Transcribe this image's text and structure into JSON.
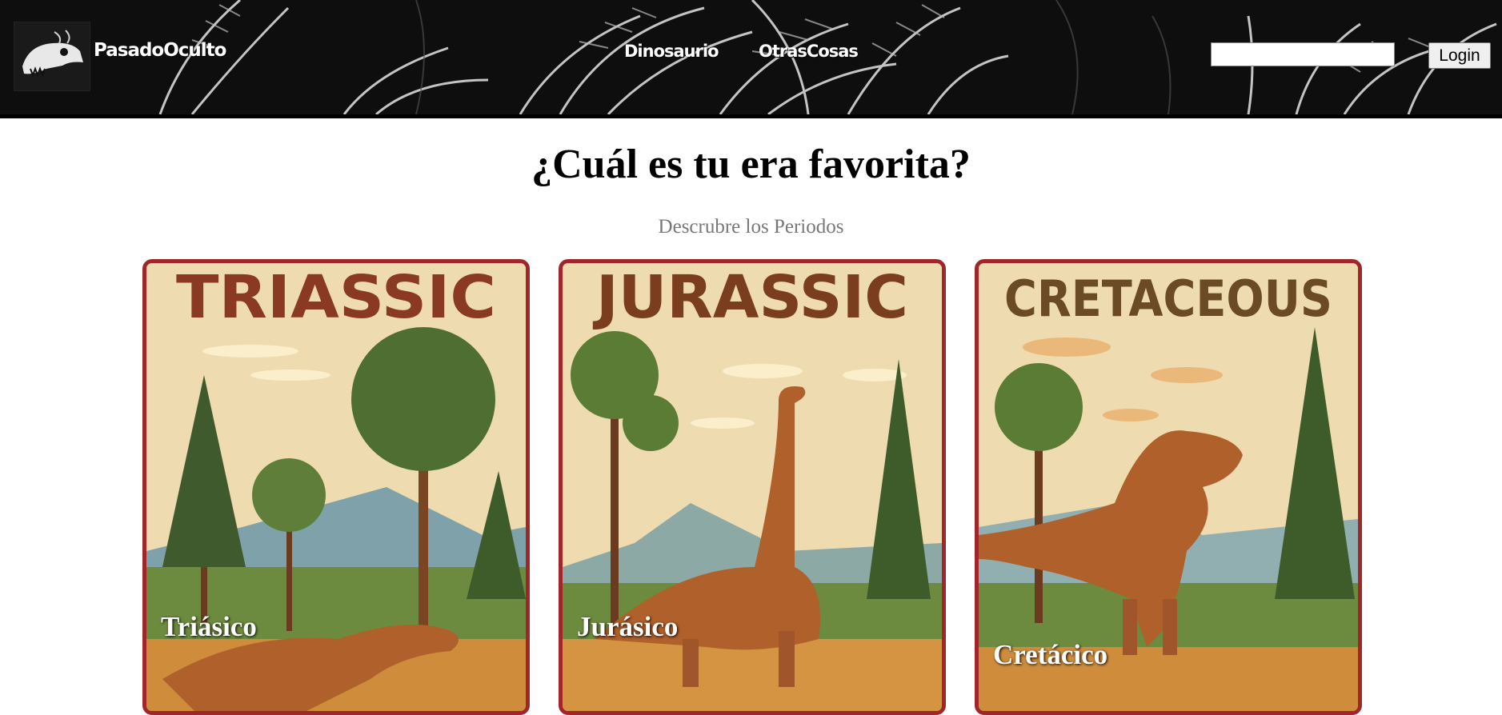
{
  "header": {
    "brand": "PasadoOculto",
    "nav": [
      {
        "label": "Dinosaurio"
      },
      {
        "label": "OtrasCosas"
      }
    ],
    "search": {
      "value": "",
      "placeholder": ""
    },
    "login_label": "Login"
  },
  "main": {
    "title": "¿Cuál es tu era favorita?",
    "subtitle": "Descrubre los Periodos",
    "cards": [
      {
        "poster_title": "TRIASSIC",
        "label": "Triásico",
        "title_color": "#8a3a22"
      },
      {
        "poster_title": "JURASSIC",
        "label": "Jurásico",
        "title_color": "#7a3e1e"
      },
      {
        "poster_title": "CRETACEOUS",
        "label": "Cretácico",
        "title_color": "#6b4a26"
      }
    ]
  },
  "colors": {
    "card_border": "#a1262a",
    "poster_background": "#eedcb0",
    "header_background": "#0e0e0e"
  }
}
